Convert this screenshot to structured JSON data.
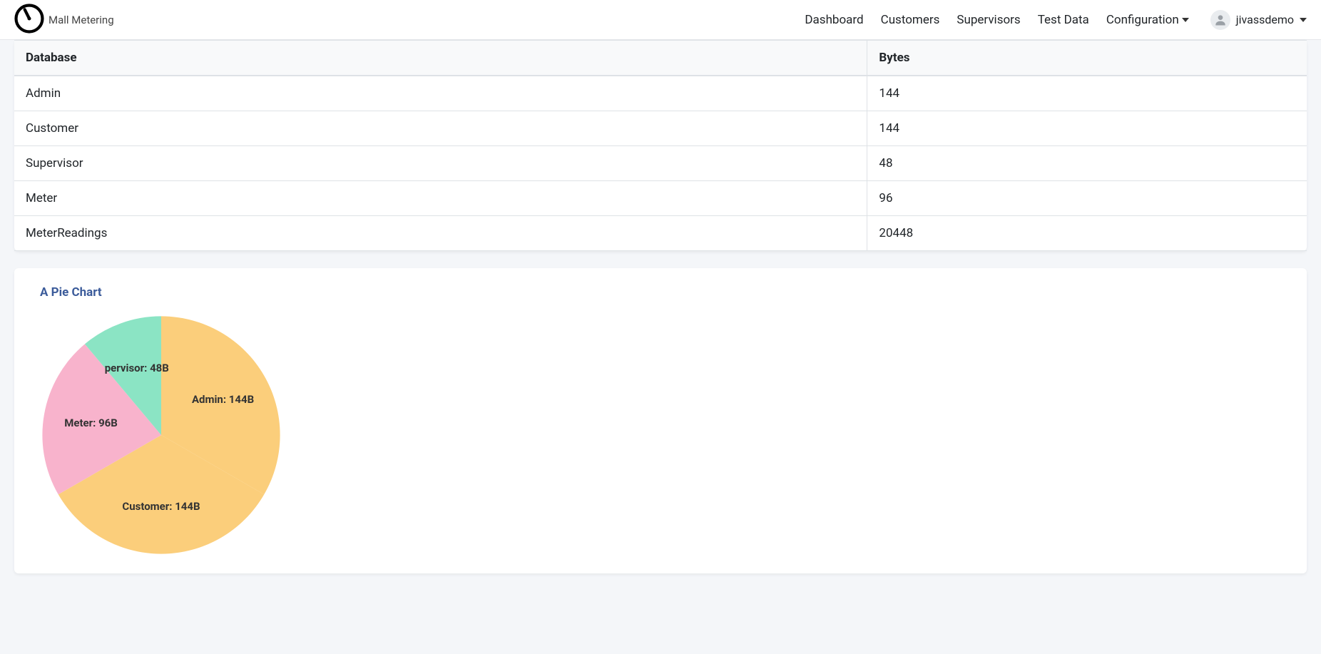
{
  "brand": {
    "name": "Mall Metering"
  },
  "nav": {
    "items": [
      {
        "label": "Dashboard",
        "dropdown": false
      },
      {
        "label": "Customers",
        "dropdown": false
      },
      {
        "label": "Supervisors",
        "dropdown": false
      },
      {
        "label": "Test Data",
        "dropdown": false
      },
      {
        "label": "Configuration",
        "dropdown": true
      }
    ],
    "user": "jivassdemo"
  },
  "table": {
    "headers": {
      "database": "Database",
      "bytes": "Bytes"
    },
    "rows": [
      {
        "database": "Admin",
        "bytes": "144"
      },
      {
        "database": "Customer",
        "bytes": "144"
      },
      {
        "database": "Supervisor",
        "bytes": "48"
      },
      {
        "database": "Meter",
        "bytes": "96"
      },
      {
        "database": "MeterReadings",
        "bytes": "20448"
      }
    ]
  },
  "chart_title": "A Pie Chart",
  "chart_data": {
    "type": "pie",
    "title": "A Pie Chart",
    "series": [
      {
        "name": "Admin",
        "value": 144,
        "label": "Admin: 144B",
        "color": "#fbce7b"
      },
      {
        "name": "Customer",
        "value": 144,
        "label": "Customer: 144B",
        "color": "#fbce7b"
      },
      {
        "name": "Meter",
        "value": 96,
        "label": "Meter: 96B",
        "color": "#f8b3cc"
      },
      {
        "name": "Supervisor",
        "value": 48,
        "label": "pervisor: 48B",
        "color": "#8be4c4"
      }
    ]
  }
}
